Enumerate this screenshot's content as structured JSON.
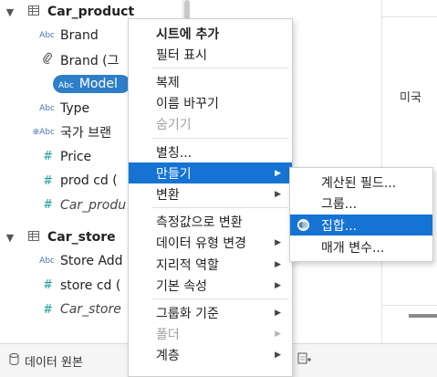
{
  "data_pane": {
    "groups": [
      {
        "name": "Car_product",
        "chevron": "▼",
        "table_icon": "table-icon",
        "fields": [
          {
            "icon": "Abc",
            "icon_name": "string-type-icon",
            "label": "Brand",
            "style": "normal"
          },
          {
            "icon": "🔗",
            "icon_name": "paperclip-group-icon",
            "label": "Brand (그",
            "style": "normal"
          },
          {
            "icon": "Abc",
            "icon_name": "string-type-icon",
            "label": "Model",
            "style": "selected"
          },
          {
            "icon": "Abc",
            "icon_name": "string-type-icon",
            "label": "Type",
            "style": "normal"
          },
          {
            "icon": "⊕Abc",
            "icon_name": "geo-string-type-icon",
            "label": "국가 브랜",
            "style": "normal"
          },
          {
            "icon": "#",
            "icon_name": "number-type-icon",
            "label": "Price",
            "style": "normal"
          },
          {
            "icon": "#",
            "icon_name": "number-type-icon",
            "label": "prod cd (",
            "style": "normal"
          },
          {
            "icon": "#",
            "icon_name": "number-type-icon",
            "label": "Car_produ",
            "style": "italic"
          }
        ]
      },
      {
        "name": "Car_store",
        "chevron": "▼",
        "table_icon": "table-icon",
        "fields": [
          {
            "icon": "Abc",
            "icon_name": "string-type-icon",
            "label": "Store Add",
            "style": "normal"
          },
          {
            "icon": "#",
            "icon_name": "number-type-icon",
            "label": "store cd (",
            "style": "normal"
          },
          {
            "icon": "#",
            "icon_name": "number-type-icon",
            "label": "Car_store",
            "style": "italic"
          }
        ]
      }
    ]
  },
  "context_menu": {
    "items": [
      {
        "label": "시트에 추가",
        "bold": true
      },
      {
        "label": "필터 표시"
      },
      {
        "separator": true
      },
      {
        "label": "복제"
      },
      {
        "label": "이름 바꾸기"
      },
      {
        "label": "숨기기",
        "disabled": true
      },
      {
        "separator": true
      },
      {
        "label": "별칭..."
      },
      {
        "label": "만들기",
        "submenu": true,
        "active": true
      },
      {
        "label": "변환",
        "submenu": true
      },
      {
        "separator": true
      },
      {
        "label": "측정값으로 변환"
      },
      {
        "label": "데이터 유형 변경",
        "submenu": true
      },
      {
        "label": "지리적 역할",
        "submenu": true
      },
      {
        "label": "기본 속성",
        "submenu": true
      },
      {
        "separator": true
      },
      {
        "label": "그룹화 기준",
        "submenu": true
      },
      {
        "label": "폴더",
        "submenu": true,
        "disabled": true
      },
      {
        "label": "계층",
        "submenu": true
      }
    ]
  },
  "submenu": {
    "items": [
      {
        "label": "계산된 필드..."
      },
      {
        "label": "그룹..."
      },
      {
        "label": "집합...",
        "active": true,
        "icon": "set-icon"
      },
      {
        "label": "매개 변수..."
      }
    ]
  },
  "right_area": {
    "label": "미국"
  },
  "bottom_bar": {
    "data_source_label": "데이터 원본",
    "data_source_icon": "database-icon",
    "new_sheet_icon": "new-worksheet-icon"
  },
  "colors": {
    "accent": "#1573d4",
    "selected_pill": "#2e7fc7",
    "string_icon": "#4a74b9",
    "number_icon": "#1a9e8f"
  }
}
